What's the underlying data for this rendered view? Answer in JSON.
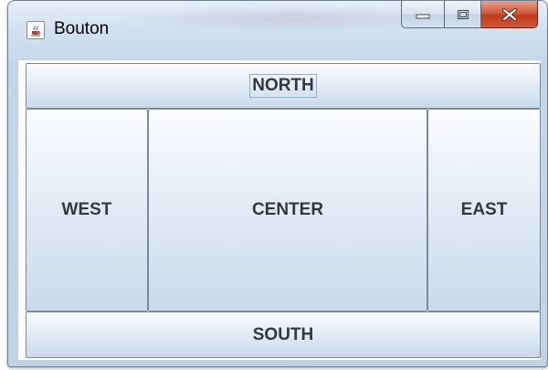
{
  "window": {
    "title": "Bouton",
    "icon": "java-cup-icon",
    "caption_buttons": [
      "minimize-icon",
      "maximize-icon",
      "close-icon"
    ],
    "close_color": "#c8401f"
  },
  "layout": {
    "north": "NORTH",
    "west": "WEST",
    "center": "CENTER",
    "east": "EAST",
    "south": "SOUTH"
  }
}
